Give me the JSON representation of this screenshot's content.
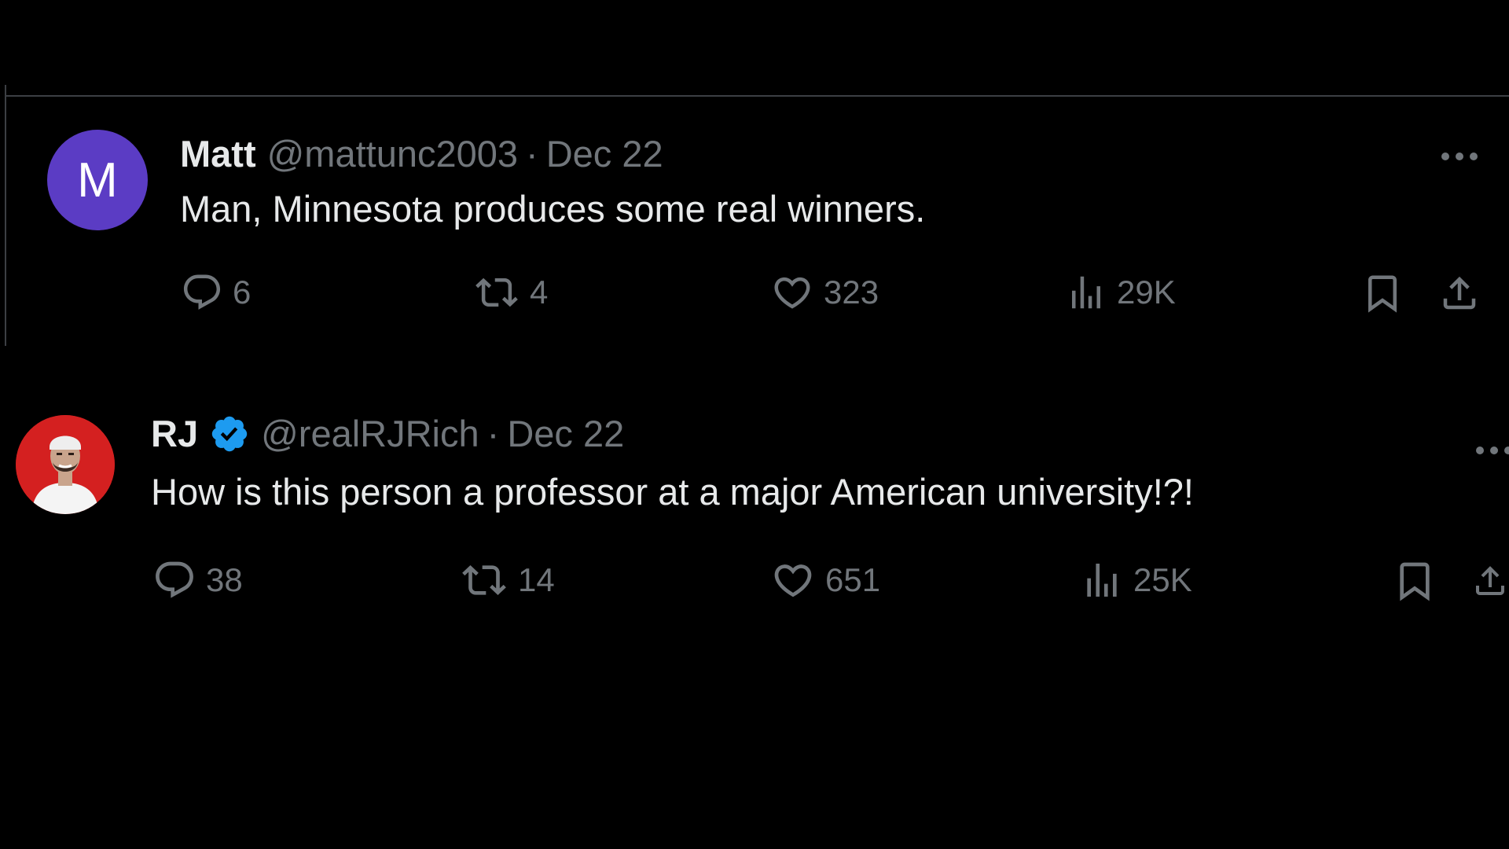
{
  "tweets": [
    {
      "avatar_letter": "M",
      "avatar_color": "#5b3cc4",
      "name": "Matt",
      "handle": "@mattunc2003",
      "separator": "·",
      "date": "Dec 22",
      "text": "Man, Minnesota produces some real winners.",
      "more_label": "···",
      "replies": "6",
      "reposts": "4",
      "likes": "323",
      "views": "29K"
    },
    {
      "avatar_icon": "profile-photo",
      "name": "RJ",
      "verified": true,
      "handle": "@realRJRich",
      "separator": "·",
      "date": "Dec 22",
      "text": "How is this person a professor at a major American university!?!",
      "more_label": "···",
      "replies": "38",
      "reposts": "14",
      "likes": "651",
      "views": "25K"
    }
  ],
  "colors": {
    "background": "#000000",
    "text_primary": "#e7e9ea",
    "text_secondary": "#71767b",
    "verified_blue": "#1d9bf0",
    "divider": "#3c3f44"
  }
}
